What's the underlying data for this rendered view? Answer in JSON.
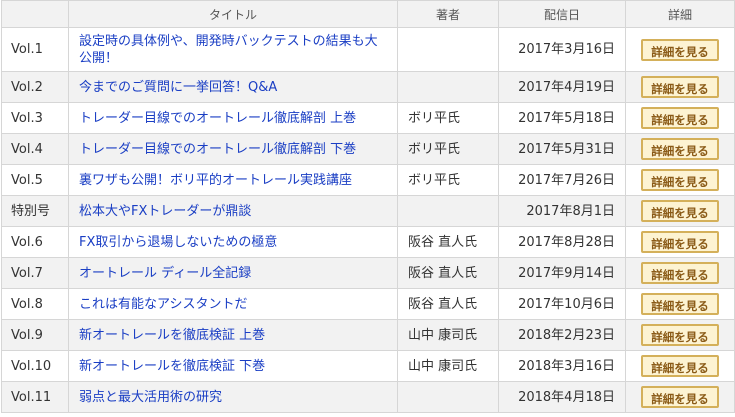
{
  "table": {
    "headers": [
      "",
      "タイトル",
      "著者",
      "配信日",
      "詳細"
    ],
    "button_label": "詳細を見る",
    "rows": [
      {
        "vol": "Vol.1",
        "title": "設定時の具体例や、開発時バックテストの結果も大公開！",
        "author": "",
        "date": "2017年3月16日",
        "detail": "詳細を見る"
      },
      {
        "vol": "Vol.2",
        "title": "今までのご質問に一挙回答！Q&A",
        "author": "",
        "date": "2017年4月19日",
        "detail": "詳細を見る"
      },
      {
        "vol": "Vol.3",
        "title": "トレーダー目線でのオートレール徹底解剖 上巻",
        "author": "ボリ平氏",
        "date": "2017年5月18日",
        "detail": "詳細を見る"
      },
      {
        "vol": "Vol.4",
        "title": "トレーダー目線でのオートレール徹底解剖 下巻",
        "author": "ボリ平氏",
        "date": "2017年5月31日",
        "detail": "詳細を見る"
      },
      {
        "vol": "Vol.5",
        "title": "裏ワザも公開！ボリ平的オートレール実践講座",
        "author": "ボリ平氏",
        "date": "2017年7月26日",
        "detail": "詳細を見る"
      },
      {
        "vol": "特別号",
        "title": "松本大やFXトレーダーが鼎談",
        "author": "",
        "date": "2017年8月1日",
        "detail": "詳細を見る"
      },
      {
        "vol": "Vol.6",
        "title": "FX取引から退場しないための極意",
        "author": "阪谷 直人氏",
        "date": "2017年8月28日",
        "detail": "詳細を見る"
      },
      {
        "vol": "Vol.7",
        "title": "オートレール ディール全記録",
        "author": "阪谷 直人氏",
        "date": "2017年9月14日",
        "detail": "詳細を見る"
      },
      {
        "vol": "Vol.8",
        "title": "これは有能なアシスタントだ",
        "author": "阪谷 直人氏",
        "date": "2017年10月6日",
        "detail": "詳細を見る"
      },
      {
        "vol": "Vol.9",
        "title": "新オートレールを徹底検証 上巻",
        "author": "山中 康司氏",
        "date": "2018年2月23日",
        "detail": "詳細を見る"
      },
      {
        "vol": "Vol.10",
        "title": "新オートレールを徹底検証 下巻",
        "author": "山中 康司氏",
        "date": "2018年3月16日",
        "detail": "詳細を見る"
      },
      {
        "vol": "Vol.11",
        "title": "弱点と最大活用術の研究",
        "author": "",
        "date": "2018年4月18日",
        "detail": "詳細を見る"
      }
    ]
  },
  "colors": {
    "link": "#1a3ec4",
    "header_bg": "#f2f2f2",
    "stripe_bg": "#f2f2f2",
    "border": "#d6d6d6",
    "button_bg": "#fdf3d2",
    "button_border": "#d4b05a",
    "button_text": "#8a5a16"
  }
}
